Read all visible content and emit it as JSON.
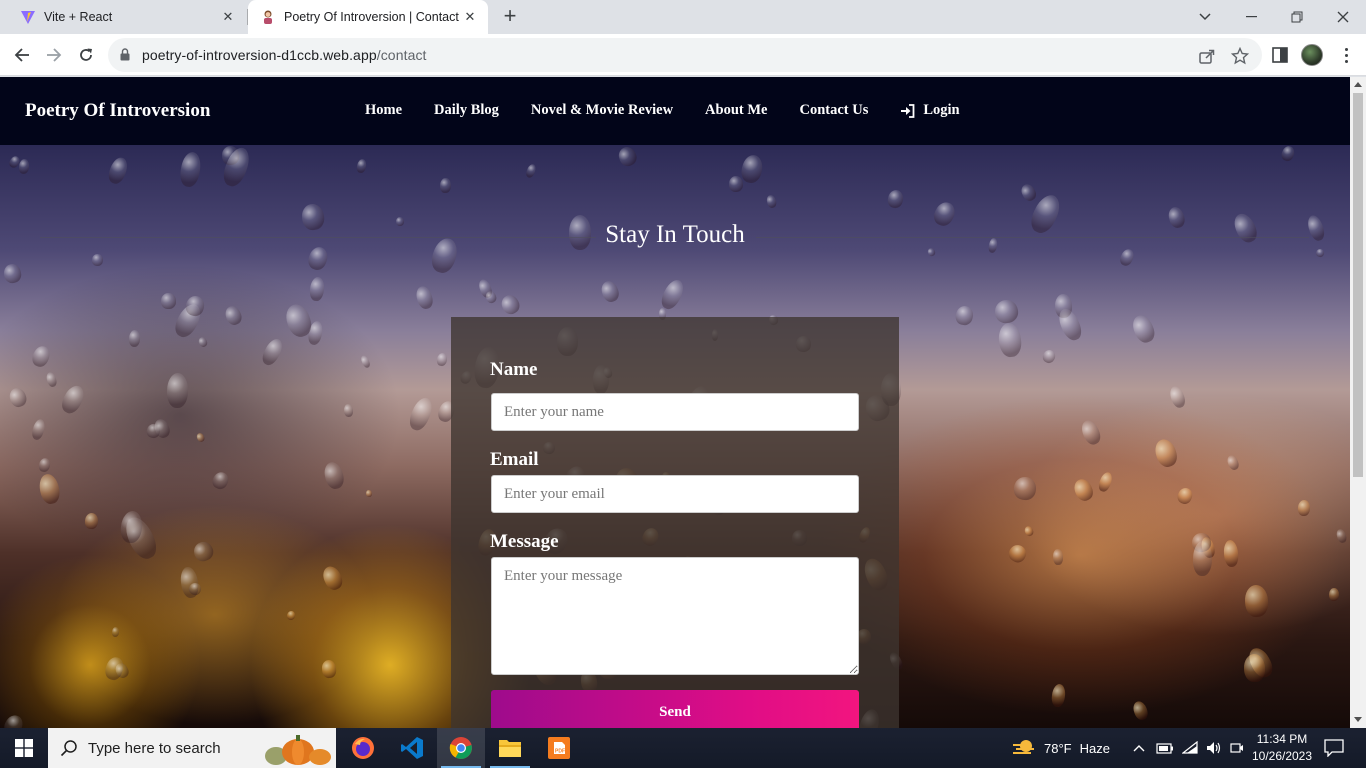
{
  "browser": {
    "tabs": [
      {
        "title": "Vite + React",
        "active": false
      },
      {
        "title": "Poetry Of Introversion | Contact",
        "active": true
      }
    ],
    "url_host": "poetry-of-introversion-d1ccb.web.app",
    "url_path": "/contact"
  },
  "site": {
    "brand": "Poetry Of Introversion",
    "nav": {
      "home": "Home",
      "daily_blog": "Daily Blog",
      "review": "Novel & Movie Review",
      "about": "About Me",
      "contact": "Contact Us",
      "login": "Login"
    },
    "section_title": "Stay In Touch",
    "form": {
      "name_label": "Name",
      "name_placeholder": "Enter your name",
      "email_label": "Email",
      "email_placeholder": "Enter your email",
      "message_label": "Message",
      "message_placeholder": "Enter your message",
      "send_label": "Send"
    }
  },
  "taskbar": {
    "search_placeholder": "Type here to search",
    "weather_temp": "78°F",
    "weather_text": "Haze",
    "time": "11:34 PM",
    "date": "10/26/2023"
  }
}
